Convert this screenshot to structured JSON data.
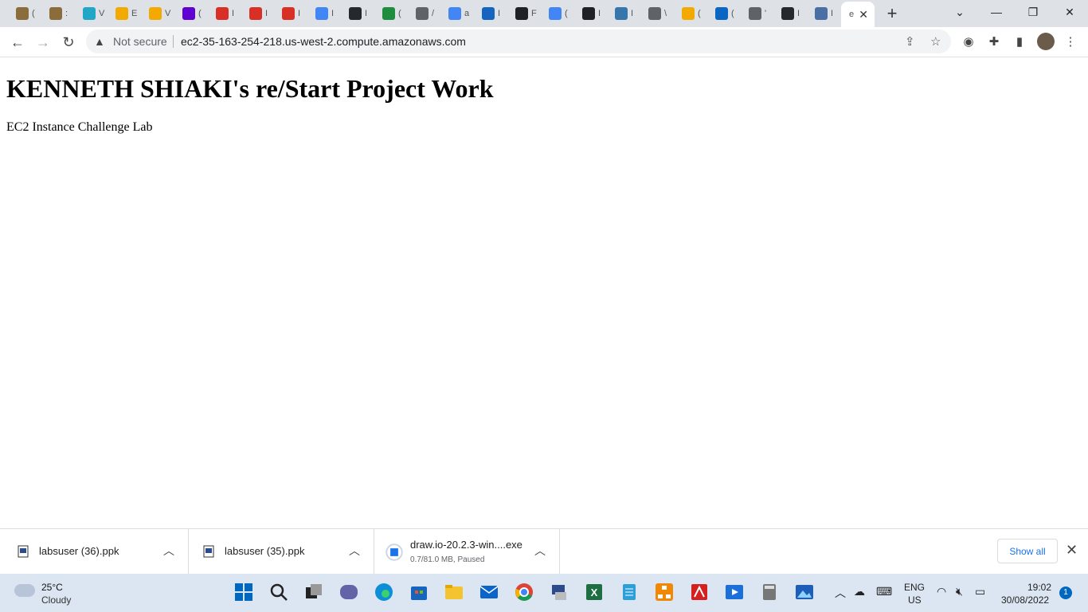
{
  "browser": {
    "tabs": [
      {
        "name": "tab-1",
        "icon": "bot-favicon",
        "color": "#8a6d3b",
        "char": "("
      },
      {
        "name": "tab-2",
        "icon": "bot-favicon",
        "color": "#8a6d3b",
        "char": ":"
      },
      {
        "name": "tab-3",
        "icon": "v-favicon",
        "color": "#22a6c7",
        "char": "V"
      },
      {
        "name": "tab-4",
        "icon": "cube-favicon",
        "color": "#f2a900",
        "char": "E"
      },
      {
        "name": "tab-5",
        "icon": "cube-favicon",
        "color": "#f2a900",
        "char": "V"
      },
      {
        "name": "tab-6",
        "icon": "mail-favicon",
        "color": "#6001d2",
        "char": "("
      },
      {
        "name": "tab-7",
        "icon": "gmail-favicon",
        "color": "#d93025",
        "char": "I"
      },
      {
        "name": "tab-8",
        "icon": "gmail-favicon",
        "color": "#d93025",
        "char": "I"
      },
      {
        "name": "tab-9",
        "icon": "gmail-favicon",
        "color": "#d93025",
        "char": "I"
      },
      {
        "name": "tab-10",
        "icon": "google-favicon",
        "color": "#4285f4",
        "char": "I"
      },
      {
        "name": "tab-11",
        "icon": "github-favicon",
        "color": "#24292f",
        "char": "I"
      },
      {
        "name": "tab-12",
        "icon": "badge-favicon",
        "color": "#1e8e3e",
        "char": "("
      },
      {
        "name": "tab-13",
        "icon": "globe-favicon",
        "color": "#5f6368",
        "char": "/"
      },
      {
        "name": "tab-14",
        "icon": "google-favicon",
        "color": "#4285f4",
        "char": "a"
      },
      {
        "name": "tab-15",
        "icon": "dots-favicon",
        "color": "#1565c0",
        "char": "I"
      },
      {
        "name": "tab-16",
        "icon": "circle-favicon",
        "color": "#202124",
        "char": "F"
      },
      {
        "name": "tab-17",
        "icon": "google-favicon",
        "color": "#4285f4",
        "char": "("
      },
      {
        "name": "tab-18",
        "icon": "circle-favicon",
        "color": "#202124",
        "char": "I"
      },
      {
        "name": "tab-19",
        "icon": "python-favicon",
        "color": "#3776ab",
        "char": "I"
      },
      {
        "name": "tab-20",
        "icon": "globe-favicon",
        "color": "#5f6368",
        "char": "\\"
      },
      {
        "name": "tab-21",
        "icon": "cube-favicon",
        "color": "#f2a900",
        "char": "("
      },
      {
        "name": "tab-22",
        "icon": "linkedin-favicon",
        "color": "#0a66c2",
        "char": "("
      },
      {
        "name": "tab-23",
        "icon": "globe-favicon",
        "color": "#5f6368",
        "char": "'"
      },
      {
        "name": "tab-24",
        "icon": "github-favicon",
        "color": "#24292f",
        "char": "I"
      },
      {
        "name": "tab-25",
        "icon": "globe-favicon",
        "color": "#4a6fa5",
        "char": "I"
      }
    ],
    "active_tab": {
      "char": "e",
      "close": "✕"
    },
    "new_tab": "+",
    "window_controls": {
      "dropdown": "⌄",
      "minimize": "—",
      "restore": "❐",
      "close": "✕"
    },
    "nav": {
      "back": "←",
      "forward": "→",
      "reload": "↻"
    },
    "security_icon": "▲",
    "security_label": "Not secure",
    "url": "ec2-35-163-254-218.us-west-2.compute.amazonaws.com"
  },
  "page": {
    "heading": "KENNETH SHIAKI's re/Start Project Work",
    "paragraph": "EC2 Instance Challenge Lab"
  },
  "downloads": {
    "items": [
      {
        "name": "labsuser (36).ppk",
        "sub": ""
      },
      {
        "name": "labsuser (35).ppk",
        "sub": ""
      },
      {
        "name": "draw.io-20.2.3-win....exe",
        "sub": "0.7/81.0 MB, Paused"
      }
    ],
    "show_all": "Show all",
    "close": "✕"
  },
  "taskbar": {
    "weather_temp": "25°C",
    "weather_condition": "Cloudy",
    "lang_top": "ENG",
    "lang_bottom": "US",
    "time": "19:02",
    "date": "30/08/2022",
    "notifications": "1"
  },
  "colors": {
    "accent": "#1a73e8",
    "taskbar": "#dce6f2",
    "tabstrip": "#dee1e6"
  }
}
